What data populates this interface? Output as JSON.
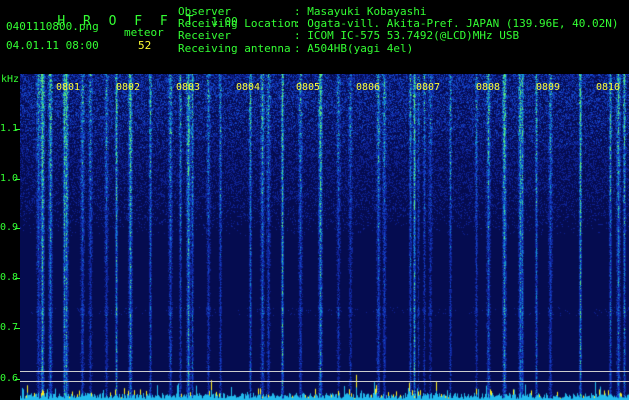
{
  "app": {
    "name": "H R O F F T",
    "version": "1.00"
  },
  "file": {
    "name": "0401110800.png",
    "datetime": "04.01.11 08:00"
  },
  "meteor": {
    "label": "meteor",
    "count": "52"
  },
  "info": [
    {
      "key": "Observer",
      "value": ": Masayuki Kobayashi"
    },
    {
      "key": "Receiving Location",
      "value": ": Ogata-vill. Akita-Pref. JAPAN (139.96E, 40.02N)"
    },
    {
      "key": "Receiver",
      "value": ": ICOM IC-575 53.7492(@LCD)MHz USB"
    },
    {
      "key": "Receiving antenna",
      "value": ": A504HB(yagi 4el)"
    }
  ],
  "axis": {
    "unit": "kHz",
    "ticks": [
      "1.1",
      "1.0",
      "0.9",
      "0.8",
      "0.7",
      "0.6"
    ]
  },
  "time_labels": [
    "0801",
    "0802",
    "0803",
    "0804",
    "0805",
    "0806",
    "0807",
    "0808",
    "0809",
    "0810"
  ],
  "colors": {
    "background": "#0a1670",
    "text_green": "#33ff33",
    "text_yellow": "#ffff33"
  }
}
